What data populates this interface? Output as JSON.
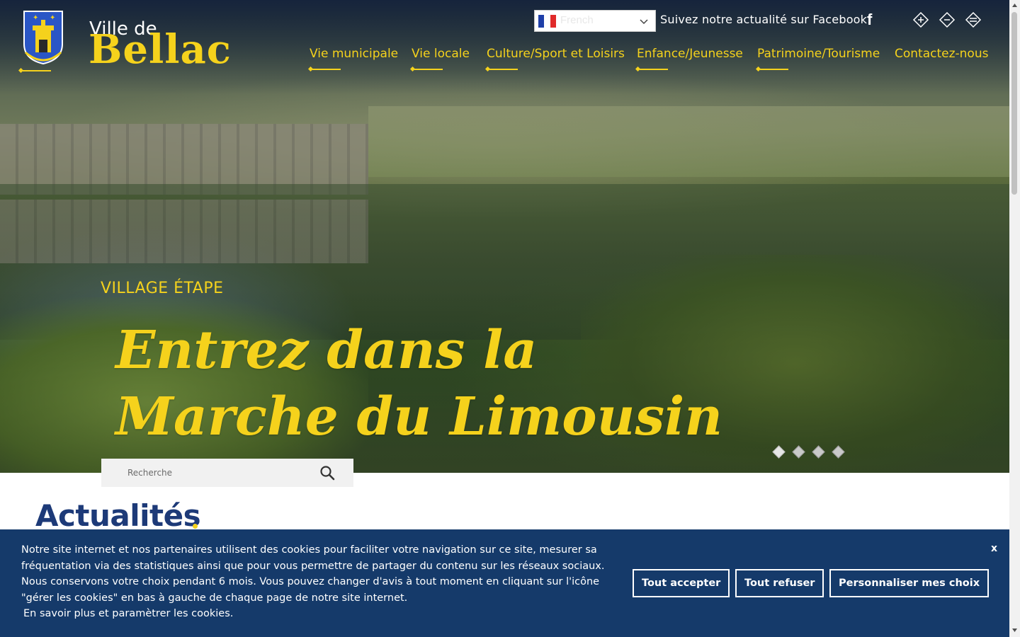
{
  "logo": {
    "ville": "Ville de",
    "name": "Bellac"
  },
  "topbar": {
    "language": "French",
    "facebook_label": "Suivez notre actualité sur Facebook"
  },
  "nav": {
    "items": [
      {
        "label": "Vie municipale"
      },
      {
        "label": "Vie locale"
      },
      {
        "label": "Culture/Sport et Loisirs"
      },
      {
        "label": "Enfance/Jeunesse"
      },
      {
        "label": "Patrimoine/Tourisme"
      },
      {
        "label": "Contactez-nous"
      }
    ]
  },
  "hero": {
    "kicker": "VILLAGE ÉTAPE",
    "headline_line1": "Entrez dans la",
    "headline_line2": "Marche du Limousin",
    "slides_count": 4,
    "active_slide": 1
  },
  "search": {
    "placeholder": "Recherche"
  },
  "news": {
    "title": "Actualités"
  },
  "cookie": {
    "text": "Notre site internet et nos partenaires utilisent des cookies pour faciliter votre navigation sur ce site, mesurer sa fréquentation via des statistiques ainsi que pour vous permettre de partager du contenu sur les réseaux sociaux. Nous conservons votre choix pendant 6 mois. Vous pouvez changer d'avis à tout moment en cliquant sur l'icône \"gérer les cookies\" en bas à gauche de chaque page de notre site internet.",
    "link": "En savoir plus et paramètrer les cookies.",
    "close": "x",
    "accept": "Tout accepter",
    "refuse": "Tout refuser",
    "customize": "Personnaliser mes choix"
  },
  "colors": {
    "accent_yellow": "#f5d21c",
    "banner_blue": "#153a6a",
    "title_blue": "#1d3a78"
  },
  "icons": {
    "facebook": "facebook-icon",
    "accessibility": [
      "increase-text-icon",
      "decrease-text-icon",
      "contrast-icon"
    ],
    "search": "search-icon",
    "language": "chevron-down-icon"
  }
}
